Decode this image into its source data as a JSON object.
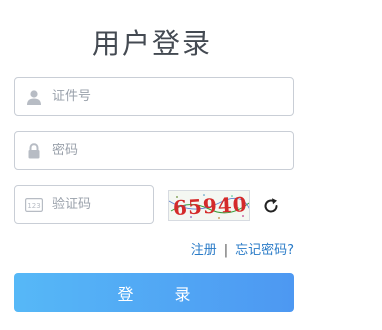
{
  "title": "用户登录",
  "form": {
    "id_placeholder": "证件号",
    "password_placeholder": "密码",
    "code_placeholder": "验证码",
    "captcha_text": "65940"
  },
  "links": {
    "register": "注册",
    "separator": "|",
    "forgot": "忘记密码?"
  },
  "login_label": "登 录",
  "icons": {
    "id": "user-icon",
    "password": "lock-icon",
    "code": "code-123-icon",
    "refresh": "refresh-icon"
  },
  "colors": {
    "accent_start": "#56b8f7",
    "accent_end": "#4d98f2",
    "link": "#2a7bc7",
    "captcha": "#d42a2a"
  }
}
